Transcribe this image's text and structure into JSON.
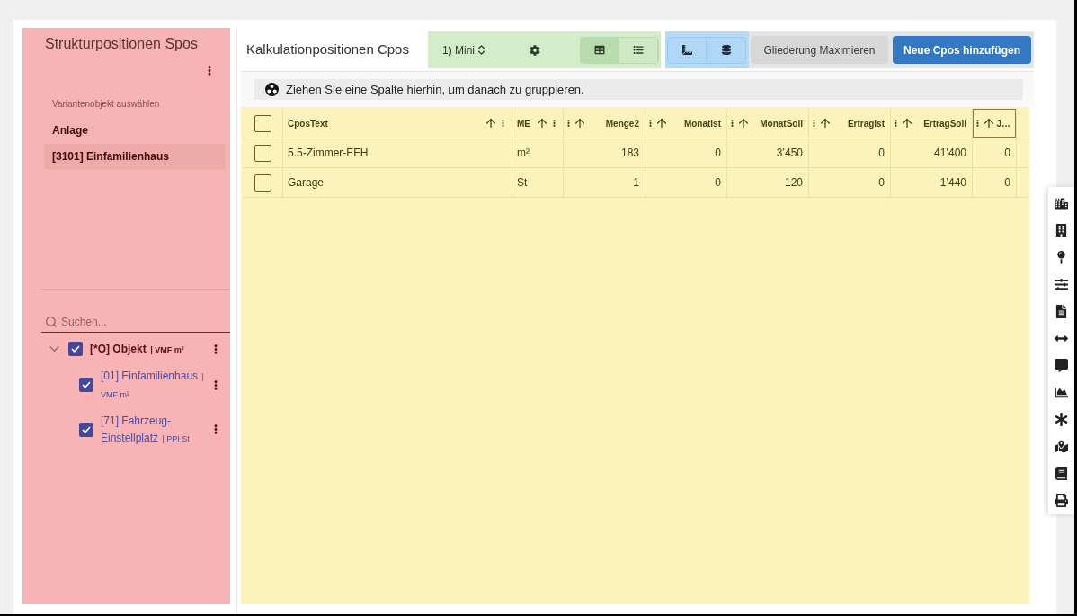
{
  "structure_panel": {
    "title": "Strukturpositionen Spos",
    "variant_picker": {
      "label": "Variantenobjekt auswählen",
      "options": [
        {
          "label": "Anlage",
          "selected": false
        },
        {
          "label": "[3101] Einfamilienhaus",
          "selected": true
        }
      ]
    },
    "search": {
      "placeholder": "Suchen..."
    },
    "tree": [
      {
        "label": "[*O] Objekt",
        "unit": "| VMF m²",
        "checked": true,
        "expanded": true,
        "children": [
          {
            "label": "[01] Einfamilienhaus",
            "unit": "| VMF m²",
            "checked": true
          },
          {
            "label": "[71] Fahrzeug-Einstellplatz",
            "unit": "| PPI St",
            "checked": true
          }
        ]
      }
    ]
  },
  "main": {
    "title": "Kalkulationpositionen Cpos",
    "toolbar": {
      "preset": "1) Mini",
      "view_modes": [
        {
          "kind": "table",
          "selected": true
        },
        {
          "kind": "list",
          "selected": false
        }
      ],
      "buttons": [
        {
          "label": "Gliederung Maximieren",
          "kind": "secondary"
        },
        {
          "label": "Neue Cpos hinzufügen",
          "kind": "primary"
        }
      ]
    },
    "group_panel": {
      "text": "Ziehen Sie eine Spalte hierhin, um danach zu gruppieren."
    },
    "table": {
      "all_checked": false,
      "columns": [
        {
          "label": "CposText",
          "kind": "text",
          "focused": false
        },
        {
          "label": "ME",
          "kind": "text",
          "focused": false
        },
        {
          "label": "Menge2",
          "kind": "number",
          "focused": false
        },
        {
          "label": "MonatIst",
          "kind": "number",
          "focused": false
        },
        {
          "label": "MonatSoll",
          "kind": "number",
          "focused": false
        },
        {
          "label": "ErtragIst",
          "kind": "number",
          "focused": false
        },
        {
          "label": "ErtragSoll",
          "kind": "number",
          "focused": false
        },
        {
          "label": "J…",
          "kind": "number",
          "focused": true
        }
      ],
      "rows": [
        {
          "checked": false,
          "cells": [
            "5.5-Zimmer-EFH",
            "m²",
            "183",
            "0",
            "3’450",
            "0",
            "41’400",
            "0"
          ]
        },
        {
          "checked": false,
          "cells": [
            "Garage",
            "St",
            "1",
            "0",
            "120",
            "0",
            "1’440",
            "0"
          ]
        }
      ]
    }
  }
}
